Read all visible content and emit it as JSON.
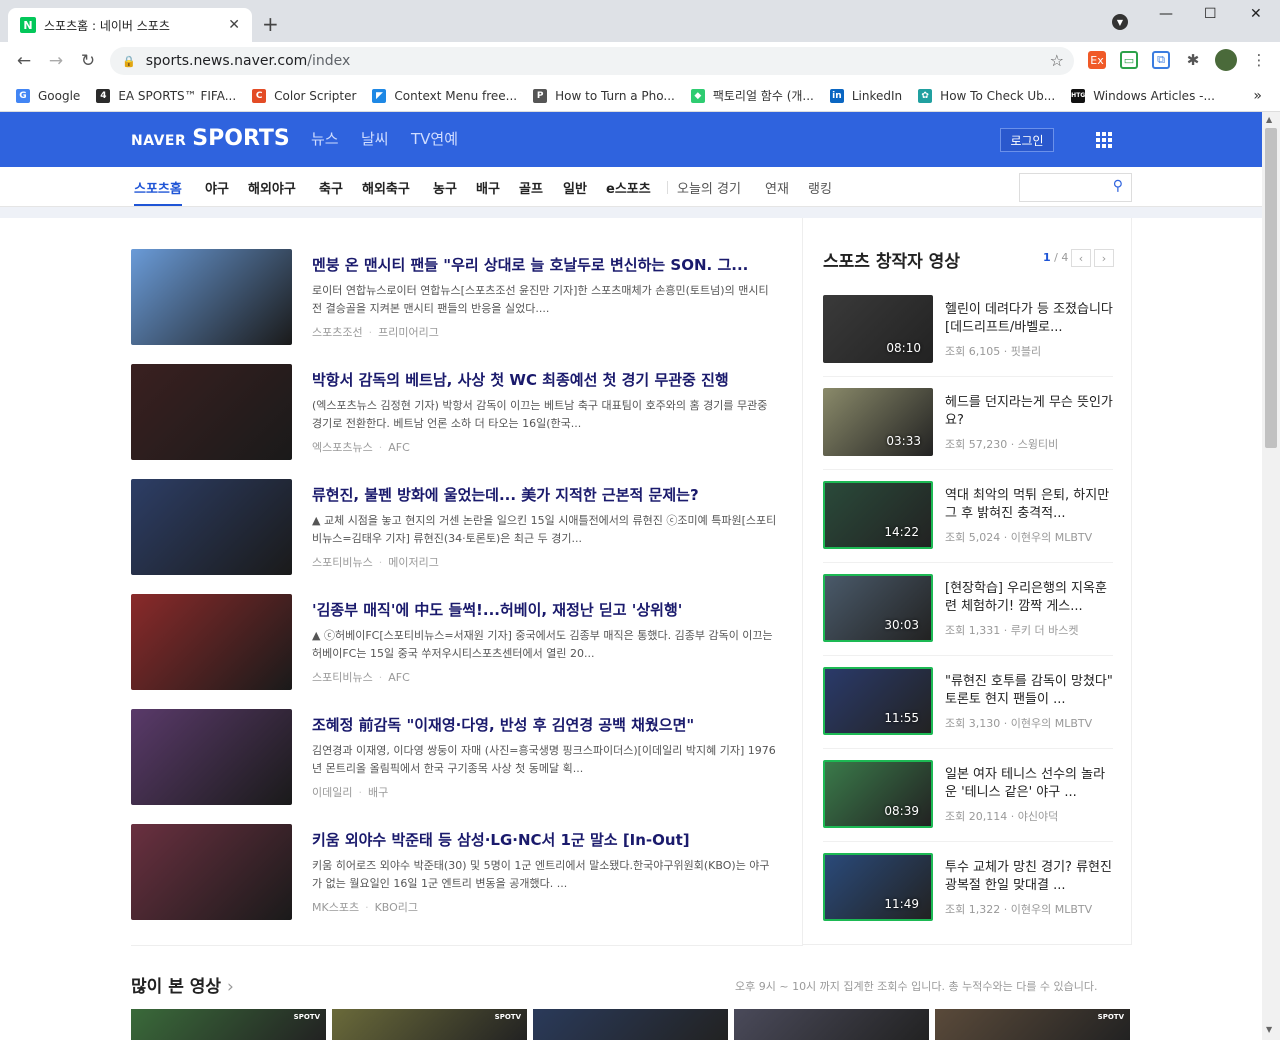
{
  "browser": {
    "tab_title": "스포츠홈 : 네이버 스포츠",
    "tab_favicon": "N",
    "new_tab": "+",
    "url_host": "sports.news.naver.com",
    "url_path": "/index",
    "bookmarks": [
      {
        "label": "Google",
        "icon": "G",
        "color": "#4285f4"
      },
      {
        "label": "EA SPORTS™ FIFA...",
        "icon": "4",
        "color": "#2b2b2b"
      },
      {
        "label": "Color Scripter",
        "icon": "C",
        "color": "#e34c26"
      },
      {
        "label": "Context Menu free...",
        "icon": "◤",
        "color": "#1e88e5"
      },
      {
        "label": "How to Turn a Pho...",
        "icon": "P",
        "color": "#555555"
      },
      {
        "label": "팩토리얼 함수 (개...",
        "icon": "◆",
        "color": "#2ecc71"
      },
      {
        "label": "LinkedIn",
        "icon": "in",
        "color": "#0a66c2"
      },
      {
        "label": "How To Check Ub...",
        "icon": "✿",
        "color": "#20a0a0"
      },
      {
        "label": "Windows Articles -...",
        "icon": "HTG",
        "color": "#111111"
      }
    ],
    "more_bookmarks": "»"
  },
  "gnb": {
    "logo_naver": "NAVER",
    "logo_sports": "SPORTS",
    "links": [
      "뉴스",
      "날씨",
      "TV연예"
    ],
    "login": "로그인"
  },
  "lnb": {
    "items": [
      "스포츠홈",
      "야구",
      "해외야구",
      "축구",
      "해외축구",
      "농구",
      "배구",
      "골프",
      "일반",
      "e스포츠"
    ],
    "sub_items": [
      "오늘의 경기",
      "연재",
      "랭킹"
    ]
  },
  "articles": [
    {
      "title": "멘붕 온 맨시티 팬들 \"우리 상대로 늘 호날두로 변신하는 SON. 그...",
      "desc": "로이터 연합뉴스로이터 연합뉴스[스포츠조선 윤진만 기자]한 스포츠매체가 손흥민(토트넘)의 맨시티전 결승골을 지켜본 맨시티 팬들의 반응을 실었다....",
      "source": "스포츠조선",
      "category": "프리미어리그",
      "thumb_color": "#6a9bd8"
    },
    {
      "title": "박항서 감독의 베트남, 사상 첫 WC 최종예선 첫 경기 무관중 진행",
      "desc": "(엑스포츠뉴스 김정현 기자) 박항서 감독이 이끄는 베트남 축구 대표팀이 호주와의 홈 경기를 무관중 경기로 전환한다. 베트남 언론 소하 더 타오는 16일(한국...",
      "source": "엑스포츠뉴스",
      "category": "AFC",
      "thumb_color": "#3a2020"
    },
    {
      "title": "류현진, 불펜 방화에 울었는데... 美가 지적한 근본적 문제는?",
      "desc": "▲ 교체 시점을 놓고 현지의 거센 논란을 일으킨 15일 시애틀전에서의 류현진 ⓒ조미예 특파원[스포티비뉴스=김태우 기자] 류현진(34·토론토)은 최근 두 경기...",
      "source": "스포티비뉴스",
      "category": "메이저리그",
      "thumb_color": "#2d3e66"
    },
    {
      "title": "'김종부 매직'에 中도 들썩!...허베이, 재정난 딛고 '상위행'",
      "desc": "▲ ⓒ허베이FC[스포티비뉴스=서재원 기자] 중국에서도 김종부 매직은 통했다. 김종부 감독이 이끄는 허베이FC는 15일 중국 쑤저우시티스포츠센터에서 열린 20...",
      "source": "스포티비뉴스",
      "category": "AFC",
      "thumb_color": "#8a2a2a"
    },
    {
      "title": "조혜정 前감독 \"이재영·다영, 반성 후 김연경 공백 채웠으면\"",
      "desc": "김연경과 이재영, 이다영 쌍둥이 자매 (사진=흥국생명 핑크스파이더스)[이데일리 박지혜 기자] 1976년 몬트리올 올림픽에서 한국 구기종목 사상 첫 동메달 획...",
      "source": "이데일리",
      "category": "배구",
      "thumb_color": "#5a3a6a"
    },
    {
      "title": "키움 외야수 박준태 등 삼성·LG·NC서 1군 말소 [In-Out]",
      "desc": "키움 히어로즈 외야수 박준태(30) 및 5명이 1군 엔트리에서 말소됐다.한국야구위원회(KBO)는 야구가 없는 월요일인 16일 1군 엔트리 변동을 공개했다. ...",
      "source": "MK스포츠",
      "category": "KBO리그",
      "thumb_color": "#6a3040"
    }
  ],
  "creator_videos": {
    "title": "스포츠 창작자 영상",
    "page_current": "1",
    "page_total": "/ 4",
    "prev": "‹",
    "next": "›",
    "items": [
      {
        "title": "헬린이 데려다가 등 조졌습니다 [데드리프트/바벨로...",
        "views": "조회 6,105",
        "channel": "핏블리",
        "duration": "08:10",
        "thumb_color": "#3a3a3a"
      },
      {
        "title": "헤드를 던지라는게 무슨 뜻인가요?",
        "views": "조회 57,230",
        "channel": "스윙티비",
        "duration": "03:33",
        "thumb_color": "#8a8a6a"
      },
      {
        "title": "역대 최악의 먹튀 은퇴, 하지만 그 후 밝혀진 충격적...",
        "views": "조회 5,024",
        "channel": "이현우의 MLBTV",
        "duration": "14:22",
        "thumb_color": "#2a4a3a"
      },
      {
        "title": "[현장학습] 우리은행의 지옥훈련 체험하기! 깜짝 게스...",
        "views": "조회 1,331",
        "channel": "루키 더 바스켓",
        "duration": "30:03",
        "thumb_color": "#4a5a6a"
      },
      {
        "title": "\"류현진 호투를 감독이 망쳤다\" 토론토 현지 팬들이 ...",
        "views": "조회 3,130",
        "channel": "이현우의 MLBTV",
        "duration": "11:55",
        "thumb_color": "#2a3a6a"
      },
      {
        "title": "일본 여자 테니스 선수의 놀라운 '테니스 같은' 야구 ...",
        "views": "조회 20,114",
        "channel": "야신야덕",
        "duration": "08:39",
        "thumb_color": "#3a7a4a"
      },
      {
        "title": "투수 교체가 망친 경기? 류현진 광복절 한일 맞대결 ...",
        "views": "조회 1,322",
        "channel": "이현우의 MLBTV",
        "duration": "11:49",
        "thumb_color": "#2a4a7a"
      }
    ]
  },
  "most_viewed": {
    "title": "많이 본 영상",
    "arrow": "›",
    "note": "오후 9시 ~ 10시 까지 집계한 조회수 입니다. 총 누적수와는 다를 수 있습니다.",
    "thumbs": [
      {
        "color": "#3a6a3a",
        "badge": "SPOTV"
      },
      {
        "color": "#6a6a3a",
        "badge": "SPOTV"
      },
      {
        "color": "#2a3a5a",
        "badge": ""
      },
      {
        "color": "#4a4a5a",
        "badge": ""
      },
      {
        "color": "#5a4a3a",
        "badge": "SPOTV"
      }
    ]
  },
  "colors": {
    "brand": "#2f63de",
    "accent": "#1f55d6",
    "title": "#1a1a6c"
  }
}
